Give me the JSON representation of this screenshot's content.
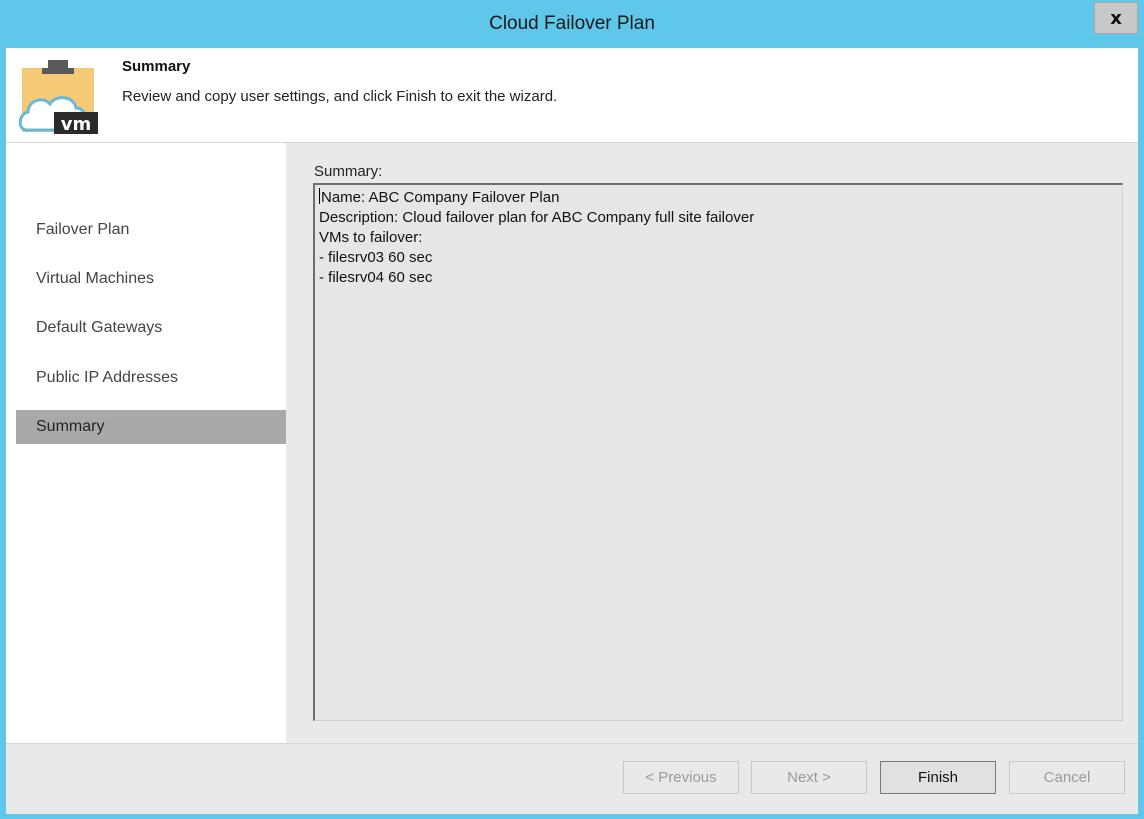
{
  "window": {
    "title": "Cloud Failover Plan",
    "close_label": "x"
  },
  "header": {
    "title": "Summary",
    "subtitle": "Review and copy user settings, and click Finish to exit the wizard.",
    "icon_text": "vm"
  },
  "nav": {
    "items": [
      {
        "label": "Failover Plan",
        "active": false
      },
      {
        "label": "Virtual Machines",
        "active": false
      },
      {
        "label": "Default Gateways",
        "active": false
      },
      {
        "label": "Public IP Addresses",
        "active": false
      },
      {
        "label": "Summary",
        "active": true
      }
    ]
  },
  "content": {
    "summary_label": "Summary:",
    "lines": [
      "Name: ABC Company Failover Plan",
      "Description: Cloud failover plan for ABC Company full site failover",
      "VMs to failover:",
      "- filesrv03 60 sec",
      "- filesrv04 60 sec"
    ]
  },
  "footer": {
    "previous_label": "< Previous",
    "next_label": "Next >",
    "finish_label": "Finish",
    "cancel_label": "Cancel"
  },
  "colors": {
    "titlebar": "#5ec7ea",
    "selected_nav": "#a9a9a9",
    "panel": "#e9e9e9"
  }
}
